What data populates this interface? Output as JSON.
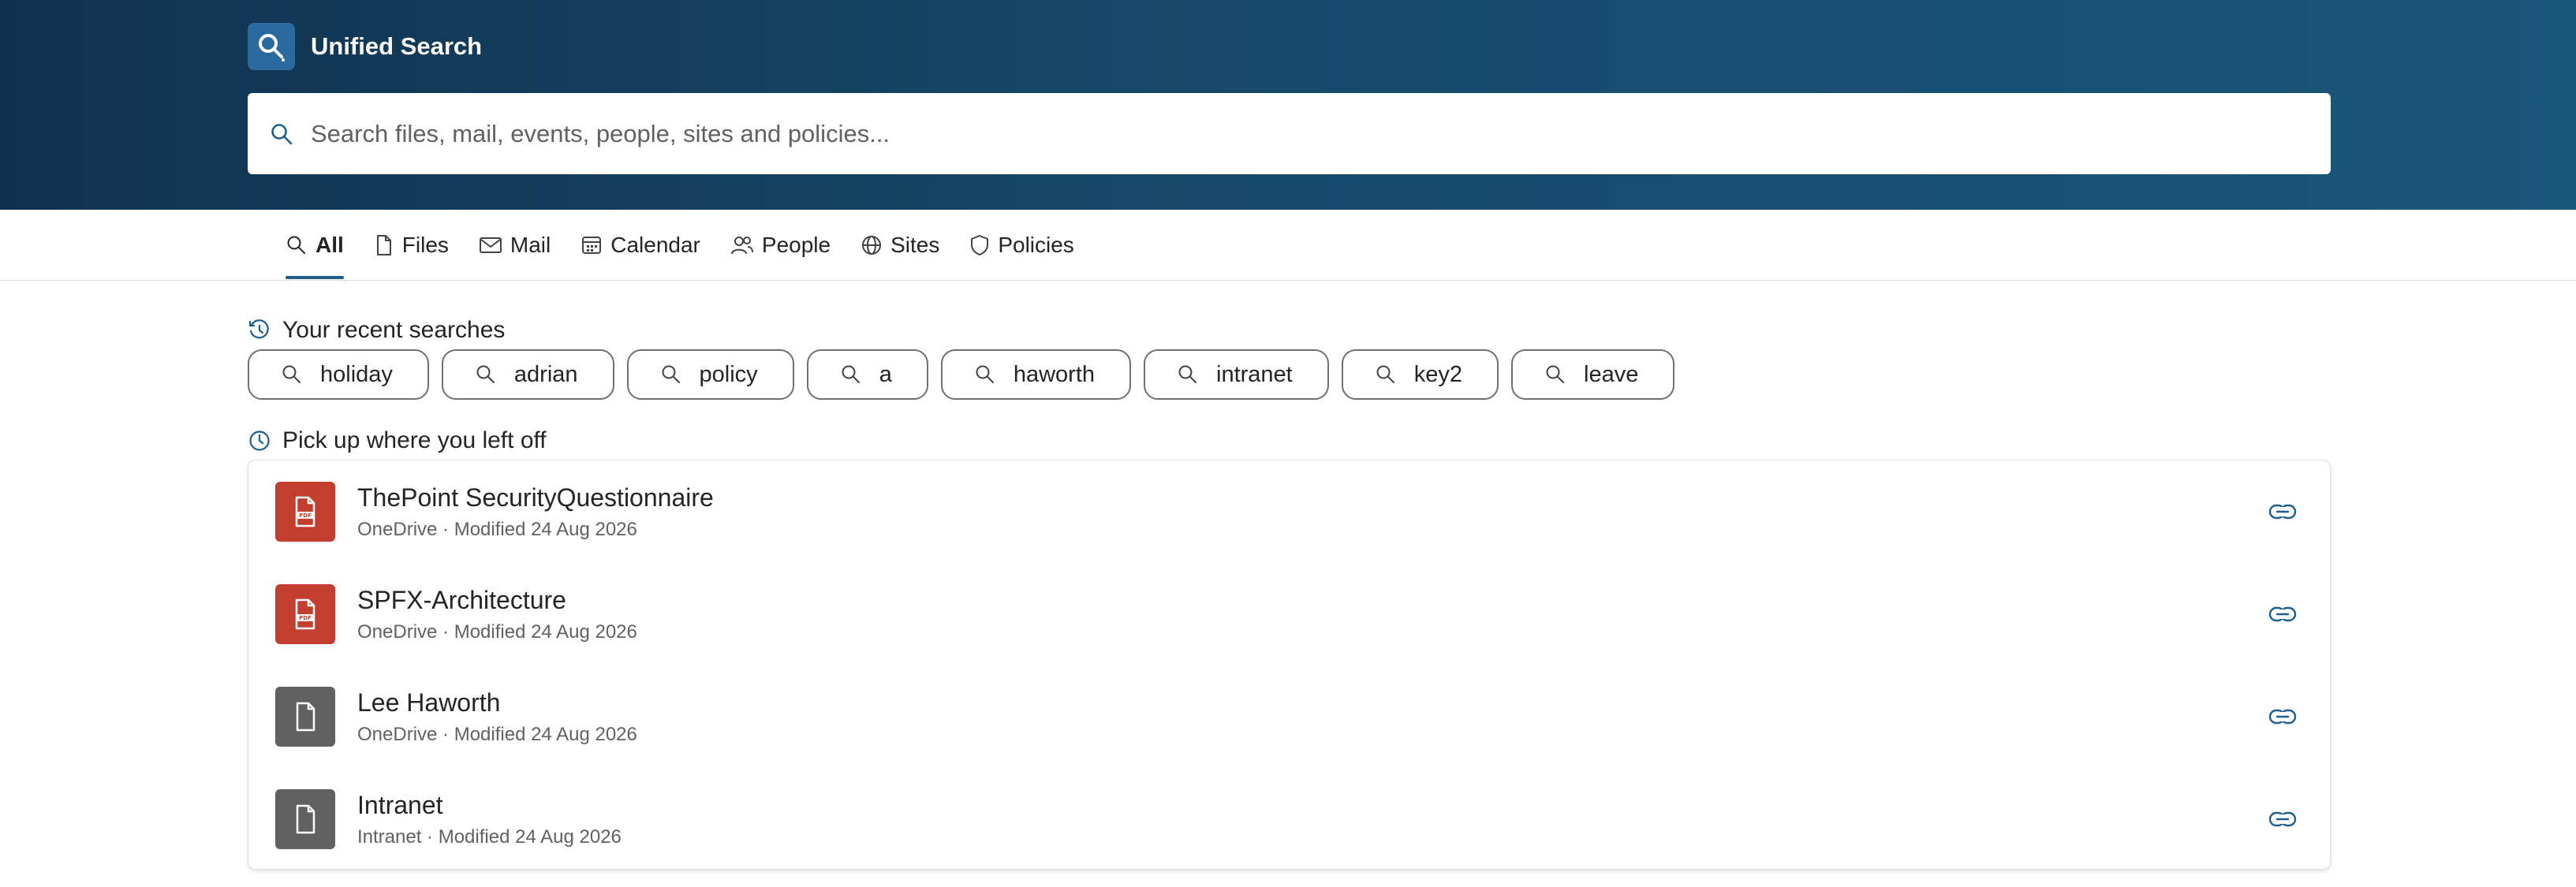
{
  "header": {
    "title": "Unified Search",
    "logo_icon": "search-icon",
    "search_placeholder": "Search files, mail, events, people, sites and policies..."
  },
  "tabs": [
    {
      "label": "All",
      "icon": "search-icon",
      "active": true
    },
    {
      "label": "Files",
      "icon": "document-icon"
    },
    {
      "label": "Mail",
      "icon": "mail-icon"
    },
    {
      "label": "Calendar",
      "icon": "calendar-icon"
    },
    {
      "label": "People",
      "icon": "people-icon"
    },
    {
      "label": "Sites",
      "icon": "globe-icon"
    },
    {
      "label": "Policies",
      "icon": "shield-icon"
    }
  ],
  "recent": {
    "title": "Your recent searches",
    "chips": [
      "holiday",
      "adrian",
      "policy",
      "a",
      "haworth",
      "intranet",
      "key2",
      "leave"
    ]
  },
  "pickup": {
    "title": "Pick up where you left off",
    "items": [
      {
        "title": "ThePoint SecurityQuestionnaire",
        "meta": "OneDrive · Modified 24 Aug 2026",
        "type": "pdf"
      },
      {
        "title": "SPFX-Architecture",
        "meta": "OneDrive · Modified 24 Aug 2026",
        "type": "pdf"
      },
      {
        "title": "Lee Haworth",
        "meta": "OneDrive · Modified 24 Aug 2026",
        "type": "document"
      },
      {
        "title": "Intranet",
        "meta": "Intranet · Modified 24 Aug 2026",
        "type": "document"
      }
    ]
  },
  "colors": {
    "header_start": "#11324f",
    "header_end": "#1a557a",
    "accent": "#1f5e8c",
    "pdf": "#c43e2f",
    "document": "#616161"
  }
}
